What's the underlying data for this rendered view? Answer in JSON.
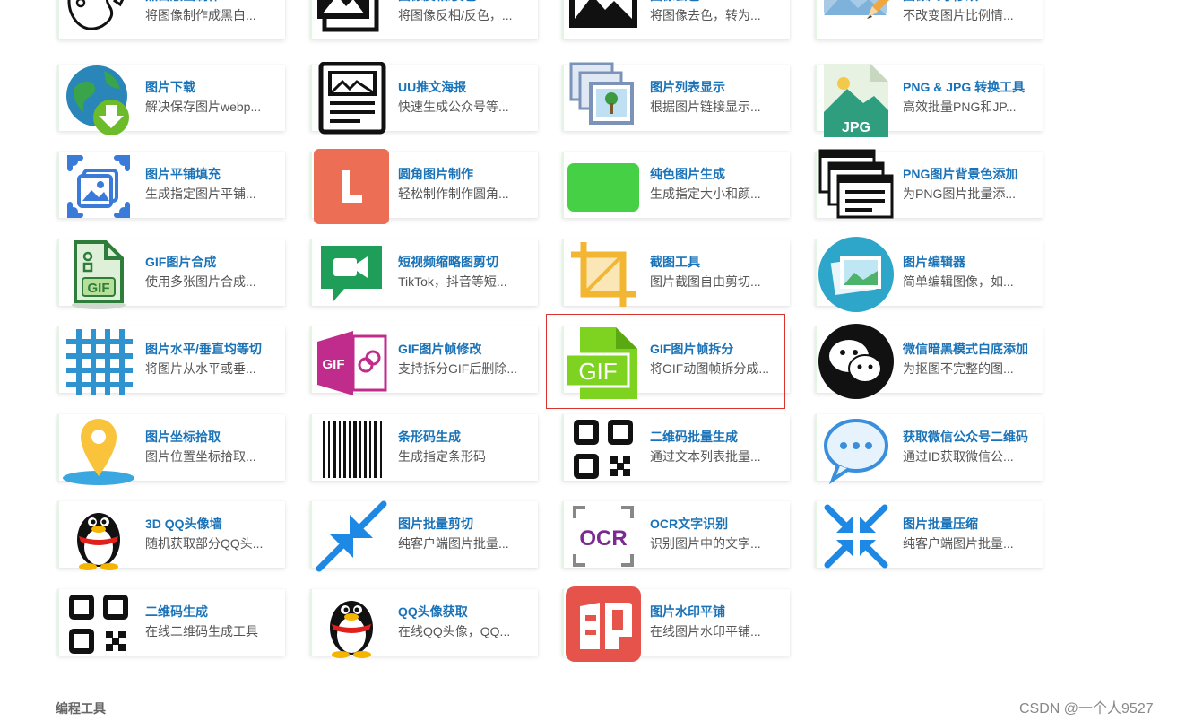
{
  "cards": [
    {
      "id": "bw",
      "title": "黑白版画制作",
      "desc": "将图像制作成黑白...",
      "icon": "palette-icon"
    },
    {
      "id": "invert",
      "title": "图像反相/反色",
      "desc": "将图像反相/反色，...",
      "icon": "image-stack-icon"
    },
    {
      "id": "gray",
      "title": "图像去色",
      "desc": "将图像去色，转为...",
      "icon": "mountain-image-icon"
    },
    {
      "id": "resize",
      "title": "图像尺寸修改",
      "desc": "不改变图片比例情...",
      "icon": "image-pencil-icon"
    },
    {
      "id": "download",
      "title": "图片下载",
      "desc": "解决保存图片webp...",
      "icon": "globe-download-icon"
    },
    {
      "id": "poster",
      "title": "UU推文海报",
      "desc": "快速生成公众号等...",
      "icon": "poster-icon"
    },
    {
      "id": "list",
      "title": "图片列表显示",
      "desc": "根据图片链接显示...",
      "icon": "image-list-icon"
    },
    {
      "id": "pngjpg",
      "title": "PNG & JPG 转换工具",
      "desc": "高效批量PNG和JP...",
      "icon": "jpg-file-icon"
    },
    {
      "id": "tile",
      "title": "图片平铺填充",
      "desc": "生成指定图片平铺...",
      "icon": "image-frame-icon"
    },
    {
      "id": "round",
      "title": "圆角图片制作",
      "desc": "轻松制作制作圆角...",
      "icon": "rounded-corner-icon"
    },
    {
      "id": "solid",
      "title": "纯色图片生成",
      "desc": "生成指定大小和颜...",
      "icon": "solid-color-icon"
    },
    {
      "id": "pngbg",
      "title": "PNG图片背景色添加",
      "desc": "为PNG图片批量添...",
      "icon": "windows-stack-icon"
    },
    {
      "id": "gifmerge",
      "title": "GIF图片合成",
      "desc": "使用多张图片合成...",
      "icon": "gif-file-icon"
    },
    {
      "id": "videothumb",
      "title": "短视频缩略图剪切",
      "desc": "TikTok，抖音等短...",
      "icon": "video-chat-icon"
    },
    {
      "id": "crop",
      "title": "截图工具",
      "desc": "图片截图自由剪切...",
      "icon": "crop-icon"
    },
    {
      "id": "editor",
      "title": "图片编辑器",
      "desc": "简单编辑图像，如...",
      "icon": "photo-circle-icon"
    },
    {
      "id": "split",
      "title": "图片水平/垂直均等切",
      "desc": "将图片从水平或垂...",
      "icon": "grid-icon"
    },
    {
      "id": "gifedit",
      "title": "GIF图片帧修改",
      "desc": "支持拆分GIF后删除...",
      "icon": "gif-link-icon"
    },
    {
      "id": "gifsplit",
      "title": "GIF图片帧拆分",
      "desc": "将GIF动图帧拆分成...",
      "icon": "gif-green-file-icon"
    },
    {
      "id": "wechatdark",
      "title": "微信暗黑模式白底添加",
      "desc": "为抠图不完整的图...",
      "icon": "wechat-icon"
    },
    {
      "id": "coord",
      "title": "图片坐标拾取",
      "desc": "图片位置坐标拾取...",
      "icon": "map-pin-icon"
    },
    {
      "id": "barcode",
      "title": "条形码生成",
      "desc": "生成指定条形码",
      "icon": "barcode-icon"
    },
    {
      "id": "qrbatch",
      "title": "二维码批量生成",
      "desc": "通过文本列表批量...",
      "icon": "qr-code-icon"
    },
    {
      "id": "wxqr",
      "title": "获取微信公众号二维码",
      "desc": "通过ID获取微信公...",
      "icon": "chat-bubble-icon"
    },
    {
      "id": "qqwall",
      "title": "3D QQ头像墙",
      "desc": "随机获取部分QQ头...",
      "icon": "qq-penguin-icon"
    },
    {
      "id": "cut",
      "title": "图片批量剪切",
      "desc": "纯客户端图片批量...",
      "icon": "compress-arrows-icon"
    },
    {
      "id": "ocr",
      "title": "OCR文字识别",
      "desc": "识别图片中的文字...",
      "icon": "ocr-icon"
    },
    {
      "id": "compress",
      "title": "图片批量压缩",
      "desc": "纯客户端图片批量...",
      "icon": "shrink-arrows-icon"
    },
    {
      "id": "qrgen",
      "title": "二维码生成",
      "desc": "在线二维码生成工具",
      "icon": "qr-code-icon"
    },
    {
      "id": "qqavatar",
      "title": "QQ头像获取",
      "desc": "在线QQ头像，QQ...",
      "icon": "qq-penguin-icon"
    },
    {
      "id": "watermark",
      "title": "图片水印平铺",
      "desc": "在线图片水印平铺...",
      "icon": "seal-icon"
    }
  ],
  "section": {
    "title": "编程工具"
  },
  "watermark": "CSDN @一个人9527",
  "colors": {
    "title": "#1a73b8",
    "highlight": "#d9332d",
    "gifGreen": "#7ed321"
  }
}
